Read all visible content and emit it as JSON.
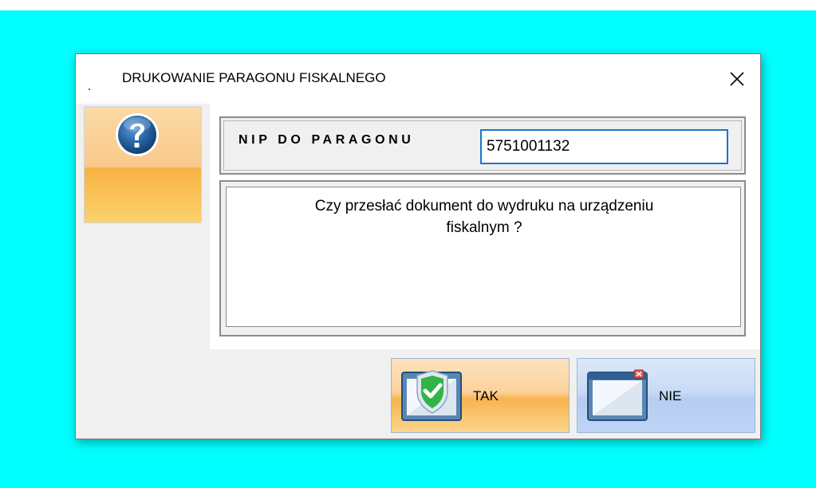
{
  "dialog": {
    "title": "DRUKOWANIE PARAGONU FISKALNEGO",
    "close_icon": "close-icon",
    "prompt_icon": "question-icon"
  },
  "nip": {
    "label": "NIP DO PARAGONU",
    "value": "5751001132"
  },
  "message": {
    "line1": "Czy przesłać dokument do wydruku na urządzeniu",
    "line2": "fiskalnym ?"
  },
  "buttons": {
    "yes": {
      "label": "TAK",
      "icon": "shield-check-icon"
    },
    "no": {
      "label": "NIE",
      "icon": "close-window-icon"
    }
  },
  "colors": {
    "background": "#00ffff",
    "yes_button": "#f8b34f",
    "no_button": "#b5cdf2",
    "input_border": "#1b74d1"
  }
}
